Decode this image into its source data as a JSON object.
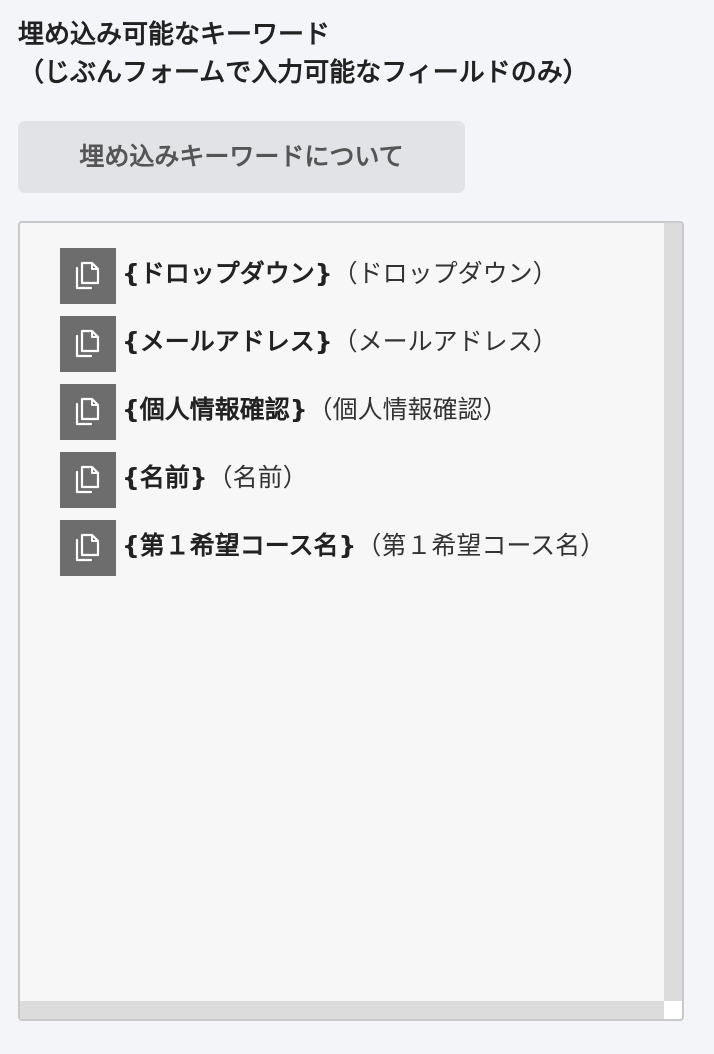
{
  "heading": {
    "line1": "埋め込み可能なキーワード",
    "line2": "（じぶんフォームで入力可能なフィールドのみ）"
  },
  "about_button": {
    "label": "埋め込みキーワードについて"
  },
  "keywords": [
    {
      "code": "{ドロップダウン}",
      "label": "（ドロップダウン）",
      "icon": "copy-icon"
    },
    {
      "code": "{メールアドレス}",
      "label": "（メールアドレス）",
      "icon": "copy-icon"
    },
    {
      "code": "{個人情報確認}",
      "label": "（個人情報確認）",
      "icon": "copy-icon"
    },
    {
      "code": "{名前}",
      "label": "（名前）",
      "icon": "copy-icon"
    },
    {
      "code": "{第１希望コース名}",
      "label": "（第１希望コース名）",
      "icon": "copy-icon"
    }
  ],
  "colors": {
    "page_background": "#f4f5f9",
    "panel_background": "#f7f7f7",
    "copy_button": "#6d6d6d",
    "about_button_background": "#e2e3e6",
    "about_button_text": "#555555"
  }
}
